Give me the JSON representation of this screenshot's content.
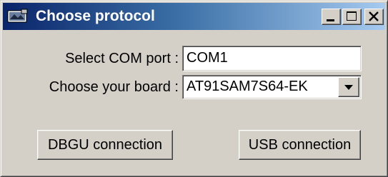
{
  "window": {
    "title": "Choose protocol",
    "icon": "app-icon",
    "controls": [
      "minimize-icon",
      "maximize-icon",
      "close-icon"
    ]
  },
  "form": {
    "com_port_label": "Select COM port :",
    "com_port_value": "COM1",
    "board_label": "Choose your board :",
    "board_value": "AT91SAM7S64-EK"
  },
  "buttons": {
    "dbgu_label": "DBGU connection",
    "usb_label": "USB connection"
  },
  "colors": {
    "title_gradient_start": "#0a246a",
    "title_gradient_end": "#a6caf0",
    "face": "#d4d0c8"
  }
}
